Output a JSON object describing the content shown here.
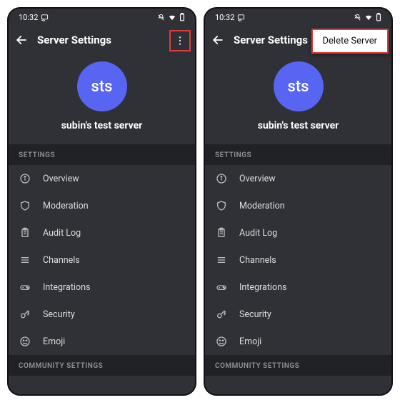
{
  "status": {
    "time": "10:32"
  },
  "header": {
    "title": "Server Settings"
  },
  "server": {
    "initials": "sts",
    "name": "subin's test server",
    "accent": "#5865f2"
  },
  "popup": {
    "delete_label": "Delete Server"
  },
  "sections": {
    "settings_label": "SETTINGS",
    "community_label": "COMMUNITY SETTINGS"
  },
  "items": [
    {
      "label": "Overview"
    },
    {
      "label": "Moderation"
    },
    {
      "label": "Audit Log"
    },
    {
      "label": "Channels"
    },
    {
      "label": "Integrations"
    },
    {
      "label": "Security"
    },
    {
      "label": "Emoji"
    }
  ]
}
